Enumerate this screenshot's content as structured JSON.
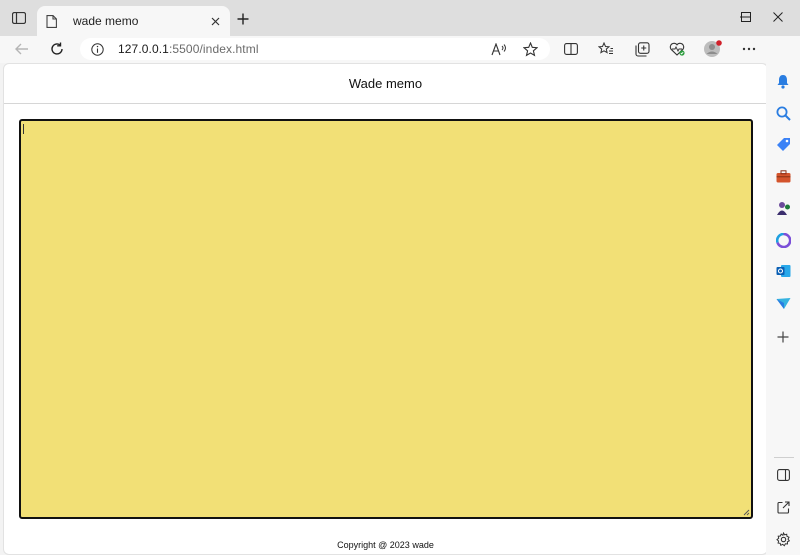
{
  "browser": {
    "tab": {
      "title": "wade memo"
    },
    "address": {
      "host": "127.0.0.1",
      "rest": ":5500/index.html"
    }
  },
  "page": {
    "header_title": "Wade memo",
    "memo_text": "",
    "footer": "Copyright @ 2023 wade"
  },
  "colors": {
    "memo_background": "#f2e076",
    "memo_border": "#111111",
    "page_background": "#ffffff",
    "chrome_background": "#f7f7f7",
    "tabstrip_background": "#dedede"
  },
  "icons": {
    "tab_actions": "tab-actions-icon",
    "favicon": "document-icon",
    "close_tab": "close-icon",
    "new_tab": "plus-icon",
    "back": "back-arrow-icon",
    "refresh": "refresh-icon",
    "site_info": "info-icon",
    "read_aloud": "read-aloud-icon",
    "favorite": "star-icon",
    "split_screen": "split-screen-icon",
    "favorites": "favorites-icon",
    "collections": "collections-icon",
    "browser_essentials": "heart-icon",
    "profile": "profile-icon",
    "more": "more-icon",
    "copilot": "copilot-icon",
    "sidebar": [
      "bell-icon",
      "search-icon",
      "tag-icon",
      "toolbox-icon",
      "games-icon",
      "microsoft365-icon",
      "outlook-icon",
      "send-icon",
      "add-icon"
    ],
    "sidebar_bottom": [
      "sidebar-toggle-icon",
      "external-link-icon",
      "settings-icon"
    ]
  }
}
